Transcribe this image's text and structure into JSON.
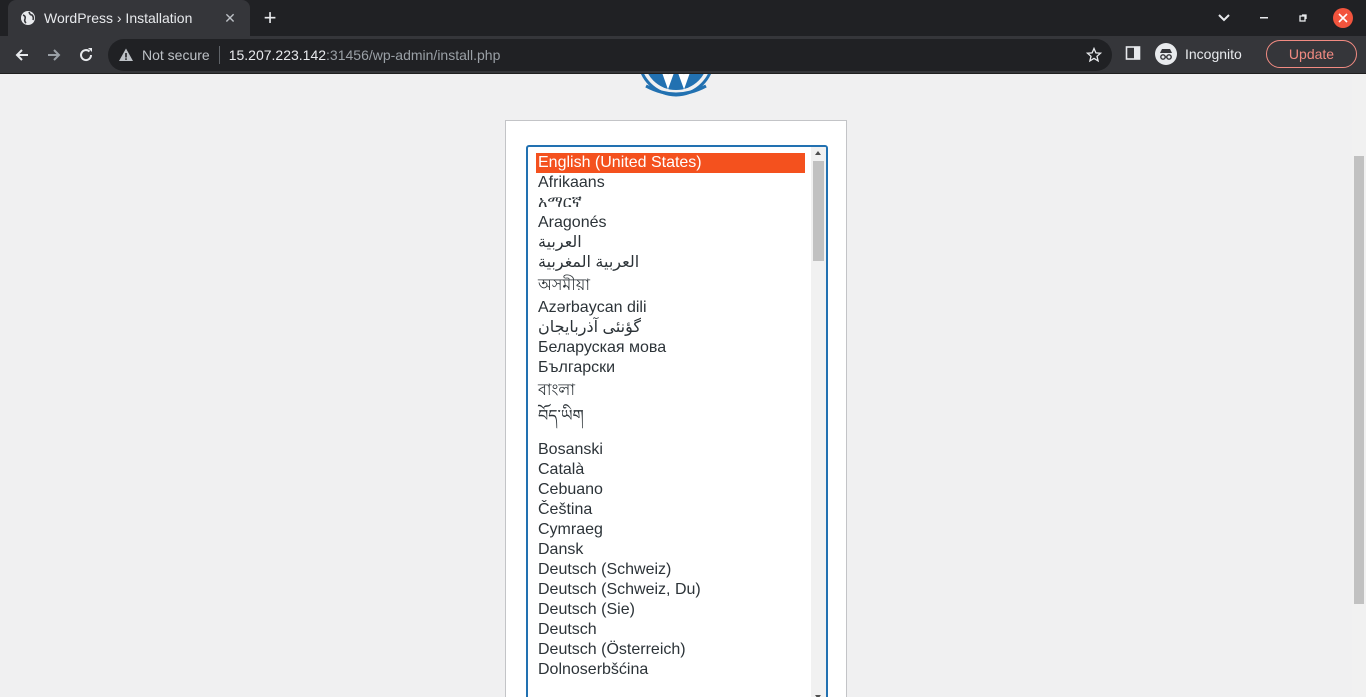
{
  "browser": {
    "tab_title": "WordPress › Installation",
    "new_tab_symbol": "+",
    "close_symbol": "✕",
    "security_label": "Not secure",
    "url_host": "15.207.223.142",
    "url_rest": ":31456/wp-admin/install.php",
    "profile_label": "Incognito",
    "update_label": "Update",
    "icons": {
      "back": "arrow-left-icon",
      "forward": "arrow-right-icon",
      "reload": "reload-icon",
      "warning": "warning-triangle-icon",
      "bookmark": "star-icon",
      "side_panel": "side-panel-icon",
      "incognito": "incognito-icon"
    },
    "colors": {
      "tab_bar": "#202124",
      "toolbar": "#35363a",
      "update_accent": "#f28b82",
      "window_close": "#f2543d"
    }
  },
  "installer": {
    "selected_index": 0,
    "languages": [
      "English (United States)",
      "Afrikaans",
      "አማርኛ",
      "Aragonés",
      "العربية",
      "العربية المغربية",
      "অসমীয়া",
      "Azərbaycan dili",
      "گؤنئی آذربایجان",
      "Беларуская мова",
      "Български",
      "বাংলা",
      "བོད་ཡིག",
      "Bosanski",
      "Català",
      "Cebuano",
      "Čeština",
      "Cymraeg",
      "Dansk",
      "Deutsch (Schweiz)",
      "Deutsch (Schweiz, Du)",
      "Deutsch (Sie)",
      "Deutsch",
      "Deutsch (Österreich)",
      "Dolnoserbšćina"
    ],
    "colors": {
      "selection": "#f4511e",
      "focus_border": "#2271b1",
      "logo": "#2271b1"
    }
  }
}
